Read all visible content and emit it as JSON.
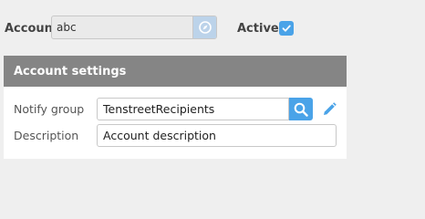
{
  "account": {
    "label": "Account",
    "value": "abc",
    "lookup_icon": "compass-icon"
  },
  "active": {
    "label": "Active",
    "checked": true
  },
  "account_settings": {
    "title": "Account settings",
    "notify_group": {
      "label": "Notify group",
      "value": "TenstreetRecipients",
      "search_icon": "search-icon",
      "edit_icon": "pencil-icon"
    },
    "description": {
      "label": "Description",
      "value": "Account description"
    }
  },
  "colors": {
    "accent": "#4aa3e8",
    "panel_header": "#858585",
    "background": "#efefef"
  }
}
